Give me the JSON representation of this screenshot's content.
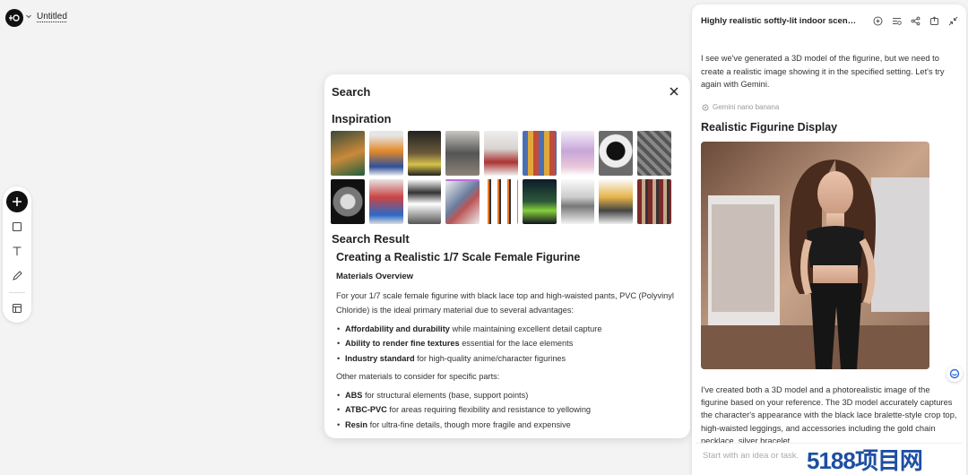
{
  "app": {
    "document_title": "Untitled"
  },
  "toolbar": {
    "tools": [
      {
        "name": "add-tool",
        "icon": "plus-icon"
      },
      {
        "name": "shape-tool",
        "icon": "square-icon"
      },
      {
        "name": "text-tool",
        "icon": "text-icon"
      },
      {
        "name": "pen-tool",
        "icon": "pencil-icon"
      },
      {
        "name": "layout-tool",
        "icon": "layout-icon"
      }
    ]
  },
  "search": {
    "title": "Search",
    "inspiration_heading": "Inspiration",
    "result_heading": "Search Result",
    "article": {
      "title": "Creating a Realistic 1/7 Scale Female Figurine",
      "section1": "Materials Overview",
      "intro": "For your 1/7 scale female figurine with black lace top and high-waisted pants, PVC (Polyvinyl Chloride) is the ideal primary material due to several advantages:",
      "bullets1": [
        {
          "bold": "Affordability and durability",
          "rest": " while maintaining excellent detail capture"
        },
        {
          "bold": "Ability to render fine textures",
          "rest": " essential for the lace elements"
        },
        {
          "bold": "Industry standard",
          "rest": " for high-quality anime/character figurines"
        }
      ],
      "other_intro": "Other materials to consider for specific parts:",
      "bullets2": [
        {
          "bold": "ABS",
          "rest": " for structural elements (base, support points)"
        },
        {
          "bold": "ATBC-PVC",
          "rest": " for areas requiring flexibility and resistance to yellowing"
        },
        {
          "bold": "Resin",
          "rest": " for ultra-fine details, though more fragile and expensive"
        }
      ]
    }
  },
  "chat": {
    "title": "Highly realistic softly-lit indoor scene...",
    "message1": "I see we've generated a 3D model of the figurine, but we need to create a realistic image showing it in the specified setting. Let's try again with Gemini.",
    "model_tag": "Gemini nano banana",
    "heading": "Realistic Figurine Display",
    "message2": "I've created both a 3D model and a photorealistic image of the figurine based on your reference. The 3D model accurately captures the character's appearance with the black lace bralette-style crop top, high-waisted leggings, and accessories including the gold chain necklace, silver bracelet",
    "input_placeholder": "Start with an idea or task."
  },
  "watermark": "5188项目网"
}
